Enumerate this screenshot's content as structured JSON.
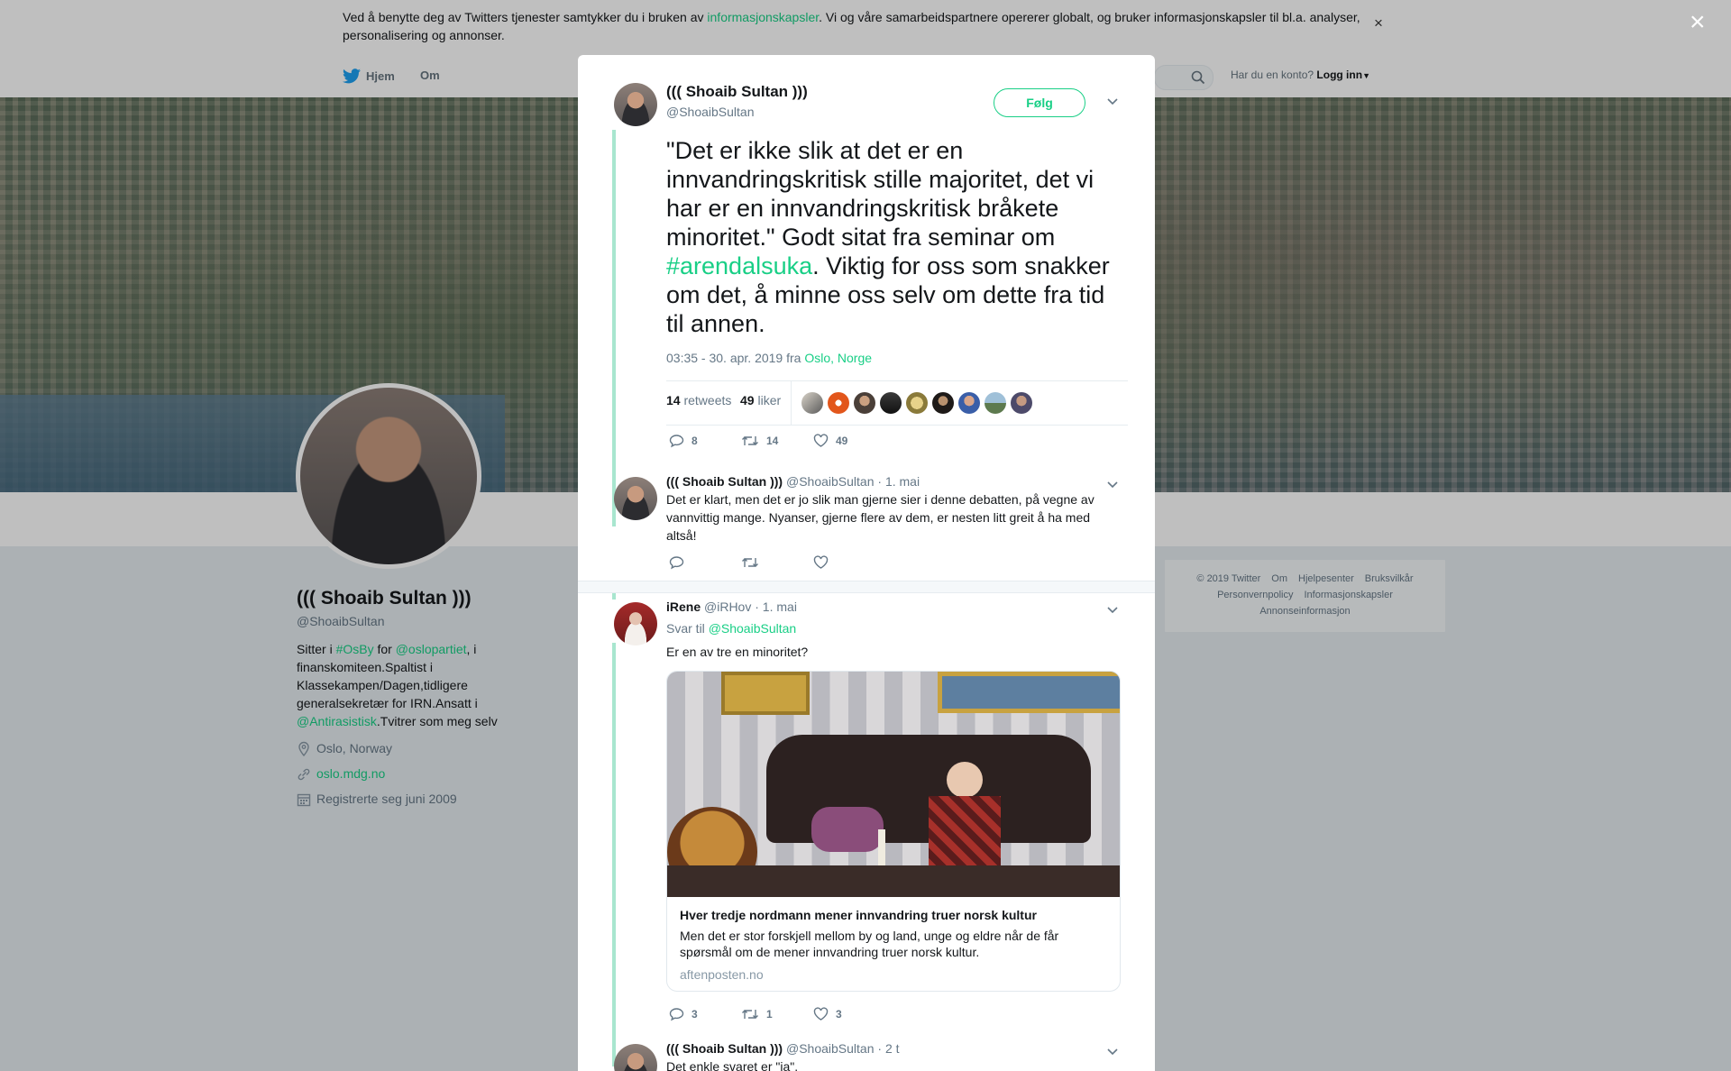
{
  "cookie_bar": {
    "text_before": "Ved å benytte deg av Twitters tjenester samtykker du i bruken av ",
    "link": "informasjonskapsler",
    "text_after": ". Vi og våre samarbeidspartnere opererer globalt, og bruker informasjonskapsler til bl.a. analyser, personalisering og annonser.",
    "close": "×"
  },
  "nav": {
    "home": "Hjem",
    "about": "Om",
    "account_prompt": "Har du en konto?",
    "login": "Logg inn"
  },
  "profile": {
    "name": "((( Shoaib Sultan )))",
    "handle": "@ShoaibSultan",
    "bio": {
      "p1": "Sitter i ",
      "tag1": "#OsBy",
      "p2": " for ",
      "mention1": "@oslopartiet",
      "p3": ", i finanskomiteen.Spaltist i Klassekampen/Dagen,tidligere generalsekretær for IRN.Ansatt i ",
      "mention2": "@Antirasistisk",
      "p4": ".Tvitrer som meg selv"
    },
    "location": "Oslo, Norway",
    "url": "oslo.mdg.no",
    "joined": "Registrerte seg juni 2009"
  },
  "footer": {
    "items": [
      "© 2019 Twitter",
      "Om",
      "Hjelpesenter",
      "Bruksvilkår",
      "Personvernpolicy",
      "Informasjonskapsler",
      "Annonseinformasjon"
    ]
  },
  "modal": {
    "close": "×",
    "main_tweet": {
      "name": "((( Shoaib Sultan )))",
      "handle": "@ShoaibSultan",
      "follow": "Følg",
      "text_part1": "\"Det er ikke slik at det er en innvandringskritisk stille majoritet,  det vi har er en innvandringskritisk bråkete minoritet.\" Godt sitat fra seminar om ",
      "hashtag": "#arendalsuka",
      "text_part2": ". Viktig for oss som snakker om det, å minne oss selv om dette fra tid til annen.",
      "time": "03:35 - 30. apr. 2019 fra ",
      "place": "Oslo, Norge",
      "retweets_count": "14",
      "retweets_label": "retweets",
      "likes_count": "49",
      "likes_label": "liker",
      "actions": {
        "replies": "8",
        "retweets": "14",
        "likes": "49"
      }
    },
    "replies": [
      {
        "name": "((( Shoaib Sultan )))",
        "handle": "@ShoaibSultan",
        "time": "· 1. mai",
        "text": "Det er klart, men det er jo slik man gjerne sier i denne debatten, på vegne av vannvittig mange. Nyanser, gjerne flere av dem, er nesten litt greit å ha med altså!",
        "actions": {
          "replies": "",
          "retweets": "",
          "likes": ""
        }
      },
      {
        "name": "iRene",
        "handle": "@iRHov",
        "time": "· 1. mai",
        "reply_to_label": "Svar til ",
        "reply_to": "@ShoaibSultan",
        "text": "Er en av tre en minoritet?",
        "card": {
          "title": "Hver tredje nordmann mener innvandring truer norsk kultur",
          "description": "Men det er stor forskjell mellom by og land, unge og eldre når de får spørsmål om de mener innvandring truer norsk kultur.",
          "domain": "aftenposten.no"
        },
        "actions": {
          "replies": "3",
          "retweets": "1",
          "likes": "3"
        }
      },
      {
        "name": "((( Shoaib Sultan )))",
        "handle": "@ShoaibSultan",
        "time": "· 2 t",
        "text": "Det enkle svaret er \"ja\"."
      }
    ]
  },
  "colors": {
    "accent": "#19cf86",
    "thread_line": "#a8e6cf",
    "muted": "#657786"
  },
  "icons": [
    "twitter-bird-icon",
    "search-icon",
    "caret-down-icon",
    "location-icon",
    "link-icon",
    "calendar-icon",
    "reply-icon",
    "retweet-icon",
    "heart-icon",
    "close-icon"
  ]
}
